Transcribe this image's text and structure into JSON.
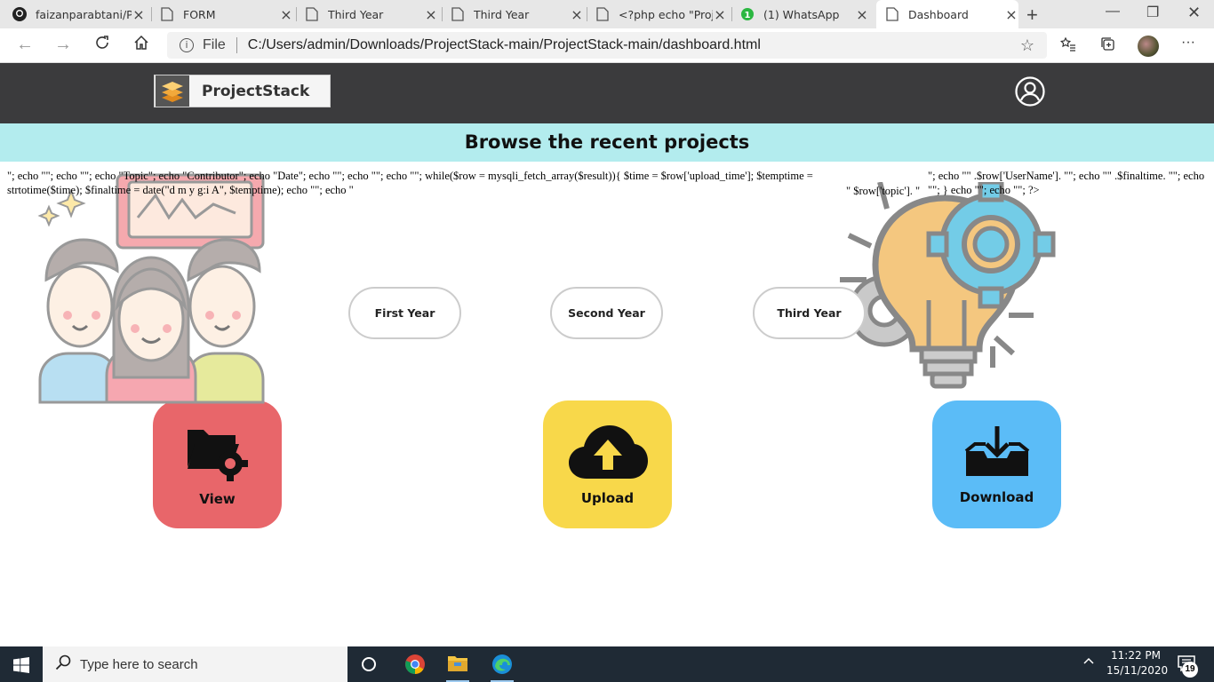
{
  "browser": {
    "tabs": [
      {
        "title": "faizanparabtani/Pr",
        "icon": "github-icon"
      },
      {
        "title": "FORM",
        "icon": "page-icon"
      },
      {
        "title": "Third Year",
        "icon": "page-icon"
      },
      {
        "title": "Third Year",
        "icon": "page-icon"
      },
      {
        "title": "<?php echo \"Proje",
        "icon": "page-icon"
      },
      {
        "title": "(1) WhatsApp",
        "icon": "whatsapp-icon",
        "badge": "1"
      },
      {
        "title": "Dashboard",
        "icon": "page-icon",
        "active": true
      }
    ],
    "address": {
      "scheme_label": "File",
      "url": "C:/Users/admin/Downloads/ProjectStack-main/ProjectStack-main/dashboard.html"
    }
  },
  "page": {
    "logo_text": "ProjectStack",
    "banner_title": "Browse the recent projects",
    "php_leak_left": "\"; echo \"\"; echo \"\"; echo \"Topic\"; echo \"Contributor\"; echo \"Date\"; echo \"\"; echo \"\"; echo \"\"; while($row = mysqli_fetch_array($result)){ $time = $row['upload_time']; $temptime = strtotime($time); $finaltime = date(\"d m y g:i A\", $temptime); echo \"\"; echo \"",
    "php_leak_mid": "\" $row['topic']. \"",
    "php_leak_right": "\"; echo \"\" .$row['UserName']. \"\"; echo \"\" .$finaltime. \"\"; echo \"\"; } echo \"\"; echo \"\"; ?>",
    "year_buttons": [
      "First Year",
      "Second Year",
      "Third Year"
    ],
    "actions": [
      {
        "label": "View",
        "color": "#e8666a",
        "icon": "folder-gear-icon"
      },
      {
        "label": "Upload",
        "color": "#f8d84a",
        "icon": "cloud-upload-icon"
      },
      {
        "label": "Download",
        "color": "#5bbcf7",
        "icon": "tray-download-icon"
      }
    ]
  },
  "taskbar": {
    "search_placeholder": "Type here to search",
    "time": "11:22 PM",
    "date": "15/11/2020",
    "notification_count": "19"
  },
  "colors": {
    "header_bg": "#3b3b3d",
    "banner_bg": "#b3ecee",
    "taskbar_bg": "#1f2a35"
  }
}
